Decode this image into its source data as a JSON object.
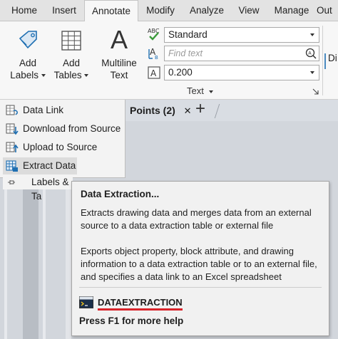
{
  "ribbon_tabs": [
    {
      "label": "Home"
    },
    {
      "label": "Insert"
    },
    {
      "label": "Annotate",
      "active": true
    },
    {
      "label": "Modify"
    },
    {
      "label": "Analyze"
    },
    {
      "label": "View"
    },
    {
      "label": "Manage"
    },
    {
      "label": "Out"
    }
  ],
  "ribbon": {
    "add_labels": {
      "line1": "Add",
      "line2": "Labels"
    },
    "add_tables": {
      "line1": "Add",
      "line2": "Tables"
    },
    "multiline_text": {
      "glyph": "A",
      "line1": "Multiline",
      "line2": "Text"
    },
    "text_style_value": "Standard",
    "find_text_placeholder": "Find text",
    "text_height_value": "0.200",
    "text_panel_title": "Text",
    "truncated_label": "Di"
  },
  "drawing_tab": {
    "label": "Points  (2)",
    "close_glyph": "✕",
    "new_tab_glyph": "+"
  },
  "menu": {
    "items": [
      {
        "label": "Data Link"
      },
      {
        "label": "Download from Source"
      },
      {
        "label": "Upload to Source"
      },
      {
        "label": "Extract Data"
      }
    ],
    "partial_item": "Labels & Ta"
  },
  "tooltip": {
    "title": "Data Extraction...",
    "description": "Extracts drawing data and merges data from an external source to a data extraction table or external file",
    "details": "Exports object property, block attribute, and drawing information to a data extraction table or to an external file, and specifies a data link to an Excel spreadsheet",
    "command": "DATAEXTRACTION",
    "help": "Press F1 for more help"
  },
  "colors": {
    "accent_blue": "#1f6fb2",
    "highlight_red": "#d9232a",
    "check_green": "#3a9a3a"
  }
}
